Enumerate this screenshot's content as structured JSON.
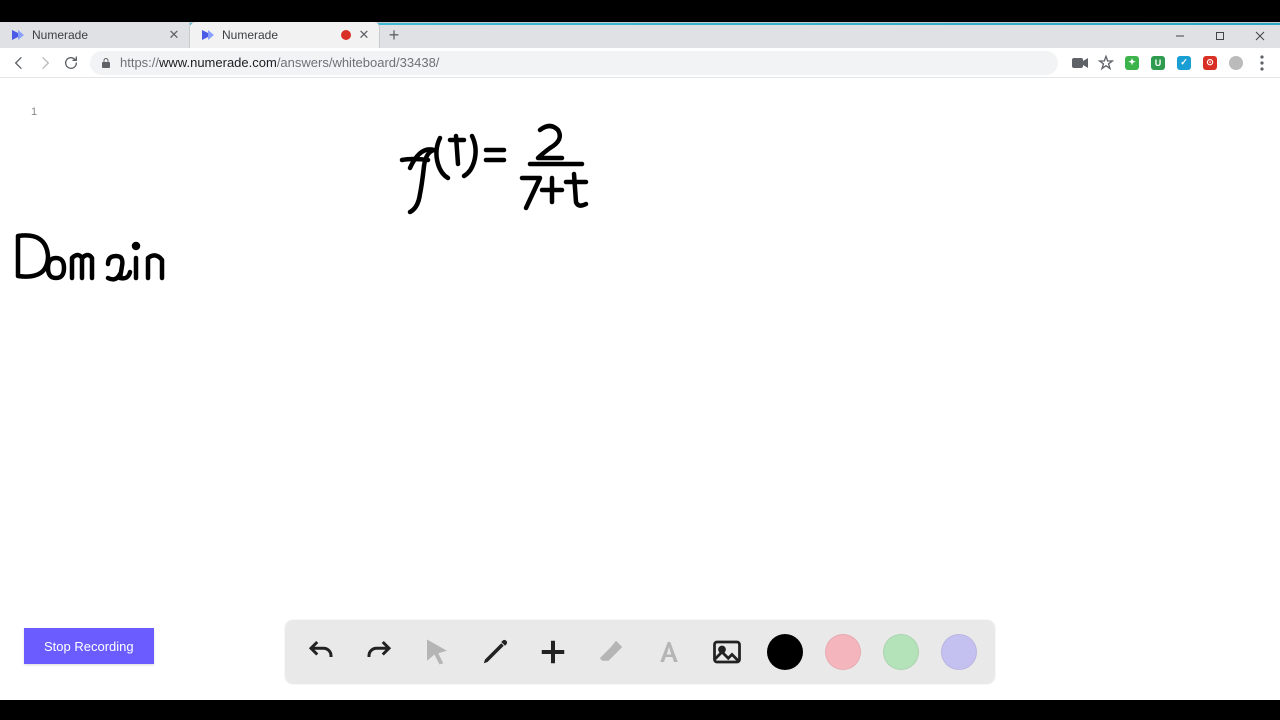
{
  "browser": {
    "tabs": [
      {
        "title": "Numerade",
        "active": false,
        "recording": false
      },
      {
        "title": "Numerade",
        "active": true,
        "recording": true
      }
    ],
    "url_protocol": "https://",
    "url_host": "www.numerade.com",
    "url_path": "/answers/whiteboard/33438/"
  },
  "page": {
    "page_number": "1",
    "stop_button_label": "Stop Recording",
    "handwriting": {
      "equation_lhs": "f(t) =",
      "equation_numerator": "2",
      "equation_denominator": "7 + t",
      "label": "Domain"
    }
  },
  "toolbar": {
    "undo": "undo",
    "redo": "redo",
    "pointer": "pointer",
    "pen": "pen",
    "add": "add",
    "eraser": "eraser",
    "text": "text",
    "image": "image",
    "colors": {
      "black": "#000000",
      "pink": "#f5b5bd",
      "green": "#b4e2b9",
      "purple": "#c4c0f0"
    }
  }
}
